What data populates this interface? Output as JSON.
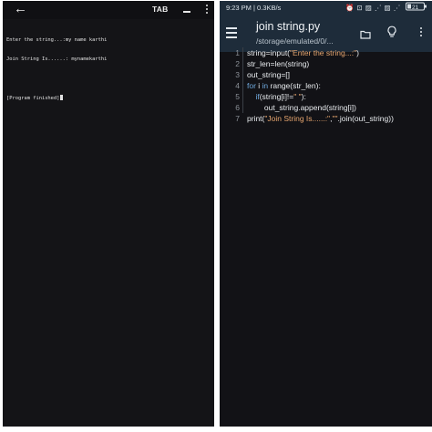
{
  "terminal": {
    "tab_label": "TAB",
    "lines": [
      "Enter the string...:my name karthi",
      "Join String Is......: mynamekarthi",
      "[Program finished]"
    ]
  },
  "editor": {
    "status_time": "9:23 PM | 0.3KB/s",
    "status_icons": "⏰ ⊡ ▨ ⋰ ▨ ⋰",
    "status_battery": "21",
    "file_title": "join string.py",
    "file_path": "/storage/emulated/0/...",
    "code_lines": [
      {
        "num": "1",
        "parts": [
          {
            "t": "string=input(",
            "c": "plain"
          },
          {
            "t": "\"Enter the string...:\"",
            "c": "str"
          },
          {
            "t": ")",
            "c": "plain"
          }
        ]
      },
      {
        "num": "2",
        "parts": [
          {
            "t": "str_len=len(string)",
            "c": "plain"
          }
        ]
      },
      {
        "num": "3",
        "parts": [
          {
            "t": "out_string=[]",
            "c": "plain"
          }
        ]
      },
      {
        "num": "4",
        "parts": [
          {
            "t": "for",
            "c": "kw"
          },
          {
            "t": " i ",
            "c": "plain"
          },
          {
            "t": "in",
            "c": "kw"
          },
          {
            "t": " range(str_len):",
            "c": "plain"
          }
        ]
      },
      {
        "num": "5",
        "parts": [
          {
            "t": "    if",
            "c": "kw"
          },
          {
            "t": "(string[i]!=",
            "c": "plain"
          },
          {
            "t": "\" \"",
            "c": "str"
          },
          {
            "t": "):",
            "c": "plain"
          }
        ]
      },
      {
        "num": "6",
        "parts": [
          {
            "t": "        out_string.append(string[i])",
            "c": "plain"
          }
        ]
      },
      {
        "num": "7",
        "parts": [
          {
            "t": "print(",
            "c": "plain"
          },
          {
            "t": "\"Join String Is......:\"",
            "c": "str"
          },
          {
            "t": ",",
            "c": "plain"
          },
          {
            "t": "\"\"",
            "c": "str"
          },
          {
            "t": ".join(out_string))",
            "c": "plain"
          }
        ]
      }
    ]
  },
  "colors": {
    "terminal_bg": "#141417",
    "editor_bg": "#121216",
    "appbar_bg": "#1e2c3a",
    "keyword": "#6fa8dc",
    "string": "#e6a56e"
  }
}
